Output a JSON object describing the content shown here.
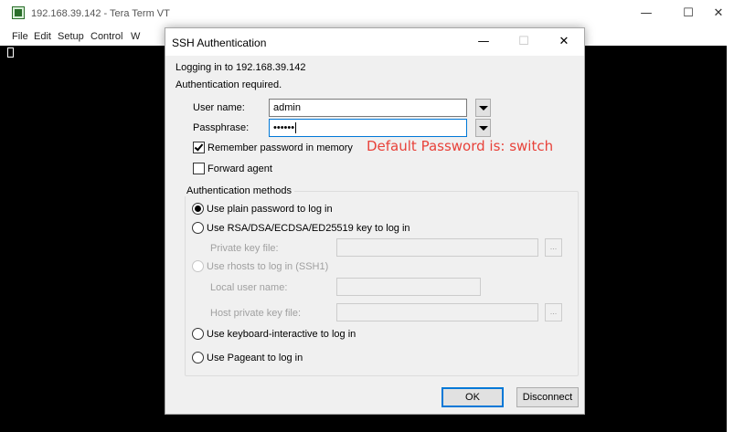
{
  "main_window": {
    "title": "192.168.39.142 - Tera Term VT",
    "controls": {
      "minimize": "—",
      "maximize": "☐",
      "close": "✕"
    },
    "menu": [
      "File",
      "Edit",
      "Setup",
      "Control",
      "W"
    ]
  },
  "dialog": {
    "title": "SSH Authentication",
    "controls": {
      "minimize": "—",
      "maximize": "☐",
      "close": "✕"
    },
    "logging_in": "Logging in to 192.168.39.142",
    "auth_required": "Authentication required.",
    "username_label": "User name:",
    "username_value": "admin",
    "passphrase_label": "Passphrase:",
    "passphrase_value": "••••••",
    "remember_label": "Remember password in memory",
    "remember_checked": true,
    "forward_label": "Forward agent",
    "forward_checked": false,
    "annotation": "Default Password is: switch",
    "auth_methods": {
      "legend": "Authentication methods",
      "plain": "Use plain password to log in",
      "rsa": "Use RSA/DSA/ECDSA/ED25519 key to log in",
      "private_key_label": "Private key file:",
      "rhosts": "Use rhosts to log in (SSH1)",
      "local_user_label": "Local user name:",
      "host_key_label": "Host private key file:",
      "keyboard": "Use keyboard-interactive to log in",
      "pageant": "Use Pageant to log in",
      "browse": "..."
    },
    "ok_label": "OK",
    "disconnect_label": "Disconnect"
  }
}
